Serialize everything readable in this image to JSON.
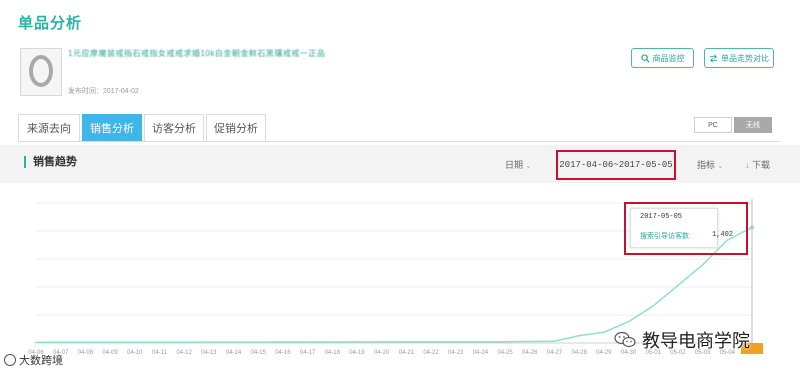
{
  "page": {
    "title": "单品分析"
  },
  "product": {
    "title": "1元应摩魔装戒指石戒指女戒戒求婚10k白金朝金鲜石黑镶戒戒一正品",
    "date": "发布时间：2017-04-02"
  },
  "actions": {
    "monitor_label": "商品监控",
    "compare_label": "单品走势对比"
  },
  "tabs": [
    {
      "label": "来源去向"
    },
    {
      "label": "销售分析"
    },
    {
      "label": "访客分析"
    },
    {
      "label": "促销分析"
    }
  ],
  "device": {
    "pc_label": "PC",
    "wireless_label": "无线"
  },
  "section": {
    "title": "销售趋势",
    "date_label": "日期",
    "date_range": "2017-04-06~2017-05-05",
    "metric_label": "指标",
    "download_label": "下载"
  },
  "tooltip": {
    "date": "2017-05-05",
    "label": "搜索引导访客数:",
    "value": "1,402"
  },
  "chart_data": {
    "type": "line",
    "x": [
      "04-06",
      "04-07",
      "04-08",
      "04-09",
      "04-10",
      "04-11",
      "04-12",
      "04-13",
      "04-14",
      "04-15",
      "04-16",
      "04-17",
      "04-18",
      "04-19",
      "04-20",
      "04-21",
      "04-22",
      "04-23",
      "04-24",
      "04-25",
      "04-26",
      "04-27",
      "04-28",
      "04-29",
      "04-30",
      "05-01",
      "05-02",
      "05-03",
      "05-04",
      "05-05"
    ],
    "series": [
      {
        "name": "搜索引导访客数",
        "values": [
          8,
          8,
          9,
          9,
          10,
          10,
          10,
          11,
          11,
          11,
          12,
          12,
          12,
          13,
          13,
          14,
          14,
          15,
          15,
          16,
          18,
          22,
          90,
          130,
          260,
          450,
          700,
          950,
          1250,
          1402
        ]
      }
    ],
    "ylim": [
      0,
      1700
    ],
    "grid": true,
    "color": "#8ee0c9"
  },
  "watermark": {
    "brand": "教导电商学院",
    "source": "大数跨境"
  }
}
